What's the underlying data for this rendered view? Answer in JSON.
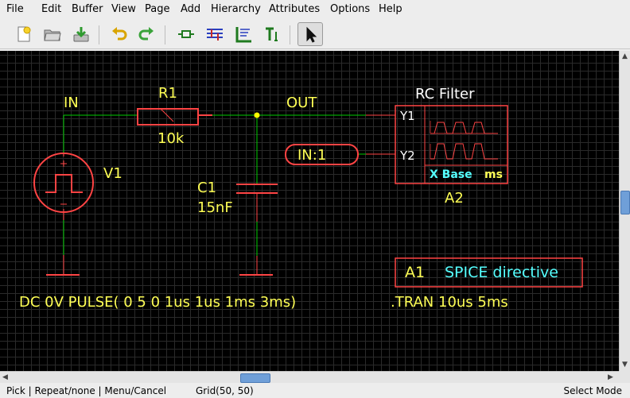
{
  "menu": [
    "File",
    "Edit",
    "Buffer",
    "View",
    "Page",
    "Add",
    "Hierarchy",
    "Attributes",
    "Options",
    "Help"
  ],
  "toolbar": {
    "icons": [
      "new-page-icon",
      "open-file-icon",
      "save-icon",
      "undo-icon",
      "redo-icon",
      "add-component-icon",
      "add-net-icon",
      "add-bus-icon",
      "add-text-icon",
      "select-pointer-icon"
    ]
  },
  "schematic": {
    "net_in_label": "IN",
    "net_out_label": "OUT",
    "r1": {
      "refdes": "R1",
      "value": "10k"
    },
    "v1": {
      "refdes": "V1"
    },
    "c1": {
      "refdes": "C1",
      "value": "15nF"
    },
    "input_port": "IN:1",
    "scope": {
      "title": "RC Filter",
      "pin1": "Y1",
      "pin2": "Y2",
      "xbase": "X Base",
      "unit": "ms",
      "refdes": "A2"
    },
    "directive": {
      "refdes": "A1",
      "label": "SPICE directive"
    },
    "source_value": "DC 0V PULSE( 0 5 0 1us 1us 1ms 3ms)",
    "tran": ".TRAN 10us 5ms"
  },
  "colors": {
    "wire": "#00cc00",
    "component": "#ff4444",
    "label": "#ffff55",
    "attribute": "#55ffff",
    "junction": "#ffff00"
  },
  "status": {
    "mouse": "Pick | Repeat/none | Menu/Cancel",
    "grid": "Grid(50, 50)",
    "mode": "Select Mode"
  }
}
